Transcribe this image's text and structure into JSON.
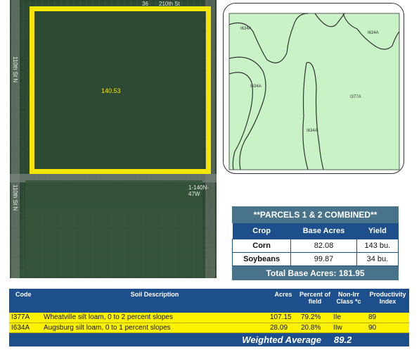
{
  "aerial": {
    "parcel_acres": "140.53",
    "labels": {
      "top_road": "210th St",
      "left_road_upper": "110th St N",
      "left_road_lower": "110th St N",
      "right_marker": "1-140N-47W",
      "corner_code": "36"
    }
  },
  "soil_map": {
    "fill_color": "#c9f3c6",
    "labels": [
      "I634A",
      "I634A",
      "I634A",
      "I377A",
      "I634A"
    ]
  },
  "parcels": {
    "title": "**PARCELS 1 & 2 COMBINED**",
    "headers": [
      "Crop",
      "Base Acres",
      "Yield"
    ],
    "rows": [
      {
        "crop": "Corn",
        "base_acres": "82.08",
        "yield": "143 bu."
      },
      {
        "crop": "Soybeans",
        "base_acres": "99.87",
        "yield": "34 bu."
      }
    ],
    "total_label": "Total Base Acres:",
    "total_value": "181.95"
  },
  "soil_table": {
    "headers": {
      "code": "Code",
      "description": "Soil Description",
      "acres": "Acres",
      "percent": "Percent of field",
      "nonirr": "Non-Irr Class *c",
      "productivity": "Productivity Index"
    },
    "rows": [
      {
        "code": "I377A",
        "description": "Wheatville silt loam, 0 to 2 percent slopes",
        "acres": "107.15",
        "percent": "79.2%",
        "nonirr": "IIe",
        "productivity": "89"
      },
      {
        "code": "I634A",
        "description": "Augsburg silt loam, 0 to 1 percent slopes",
        "acres": "28.09",
        "percent": "20.8%",
        "nonirr": "IIw",
        "productivity": "90"
      }
    ],
    "weighted_label": "Weighted Average",
    "weighted_value": "89.2"
  },
  "colors": {
    "header_blue": "#1c4f8c",
    "title_teal": "#49738b",
    "highlight_yellow": "#fbf200",
    "parcel_outline": "#f3e600"
  }
}
